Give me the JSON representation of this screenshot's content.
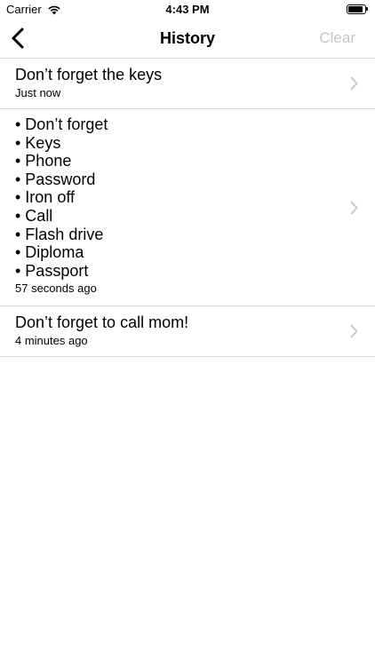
{
  "status_bar": {
    "carrier": "Carrier",
    "time": "4:43 PM",
    "battery_level": 0.95,
    "icons": [
      "wifi-icon",
      "battery-icon"
    ]
  },
  "nav": {
    "back_icon": "chevron-left-icon",
    "title": "History",
    "clear_label": "Clear",
    "clear_color": "#c4c4c8"
  },
  "history": [
    {
      "text": "Don’t forget the keys",
      "time": "Just now"
    },
    {
      "text": "• Don’t forget\n• Keys\n• Phone\n• Password\n• Iron off\n• Call\n• Flash drive\n• Diploma\n• Passport",
      "time": "57 seconds ago"
    },
    {
      "text": "Don’t forget to call mom!",
      "time": "4 minutes ago"
    }
  ],
  "colors": {
    "separator": "#d8d8d8",
    "chevron": "#c7c7cc"
  }
}
